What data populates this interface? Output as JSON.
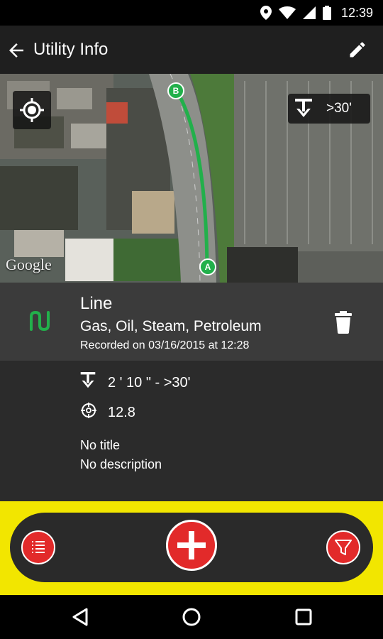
{
  "status_bar": {
    "time": "12:39",
    "icons": [
      "location-icon",
      "wifi-icon",
      "signal-icon",
      "battery-icon"
    ]
  },
  "app_bar": {
    "title": "Utility Info",
    "back_icon": "arrow-left-icon",
    "edit_icon": "pencil-icon"
  },
  "map": {
    "depth_chip_label": ">30'",
    "start_marker": "A",
    "end_marker": "B",
    "attribution": "Google",
    "line_color": "#22b04b"
  },
  "utility": {
    "type_label": "Line",
    "utility_types": "Gas, Oil, Steam, Petroleum",
    "recorded_on": "Recorded on 03/16/2015 at 12:28",
    "depth_range": "2 ' 10 \" - >30'",
    "accuracy": "12.8",
    "title": "No title",
    "description": "No description",
    "type_icon_color": "#22b04b"
  },
  "bottom_bar": {
    "accent_color": "#f2e600",
    "button_color": "#e22a2a",
    "list_icon": "list-icon",
    "add_icon": "plus-icon",
    "filter_icon": "filter-icon"
  },
  "nav_bar": {
    "back_icon": "triangle-back-icon",
    "home_icon": "circle-home-icon",
    "recents_icon": "square-recents-icon"
  }
}
